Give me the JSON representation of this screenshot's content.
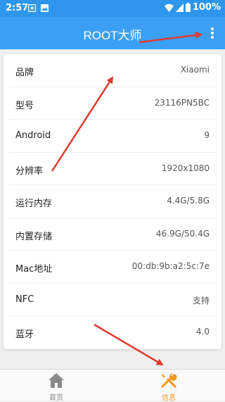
{
  "status_bar": {
    "time": "2:57",
    "battery": "100%"
  },
  "app_bar": {
    "title": "ROOT大师"
  },
  "info_rows": [
    {
      "label": "品牌",
      "value": "Xiaomi"
    },
    {
      "label": "型号",
      "value": "23116PN5BC"
    },
    {
      "label": "Android",
      "value": "9"
    },
    {
      "label": "分辨率",
      "value": "1920x1080"
    },
    {
      "label": "运行内存",
      "value": "4.4G/5.8G"
    },
    {
      "label": "内置存储",
      "value": "46.9G/50.4G"
    },
    {
      "label": "Mac地址",
      "value": "00:db:9b:a2:5c:7e"
    },
    {
      "label": "NFC",
      "value": "支持"
    },
    {
      "label": "蓝牙",
      "value": "4.0"
    }
  ],
  "bottom_nav": {
    "home_label": "首页",
    "info_label": "信息",
    "active": "info"
  },
  "colors": {
    "status_bar": "#2f96ee",
    "app_bar": "#3ba0f3",
    "active_tab": "#f29a1f",
    "inactive_tab": "#8a8a8a",
    "annotation_arrow": "#e03a2f"
  },
  "icons": {
    "more": "more-vert-icon",
    "home": "home-icon",
    "info": "tools-icon"
  }
}
